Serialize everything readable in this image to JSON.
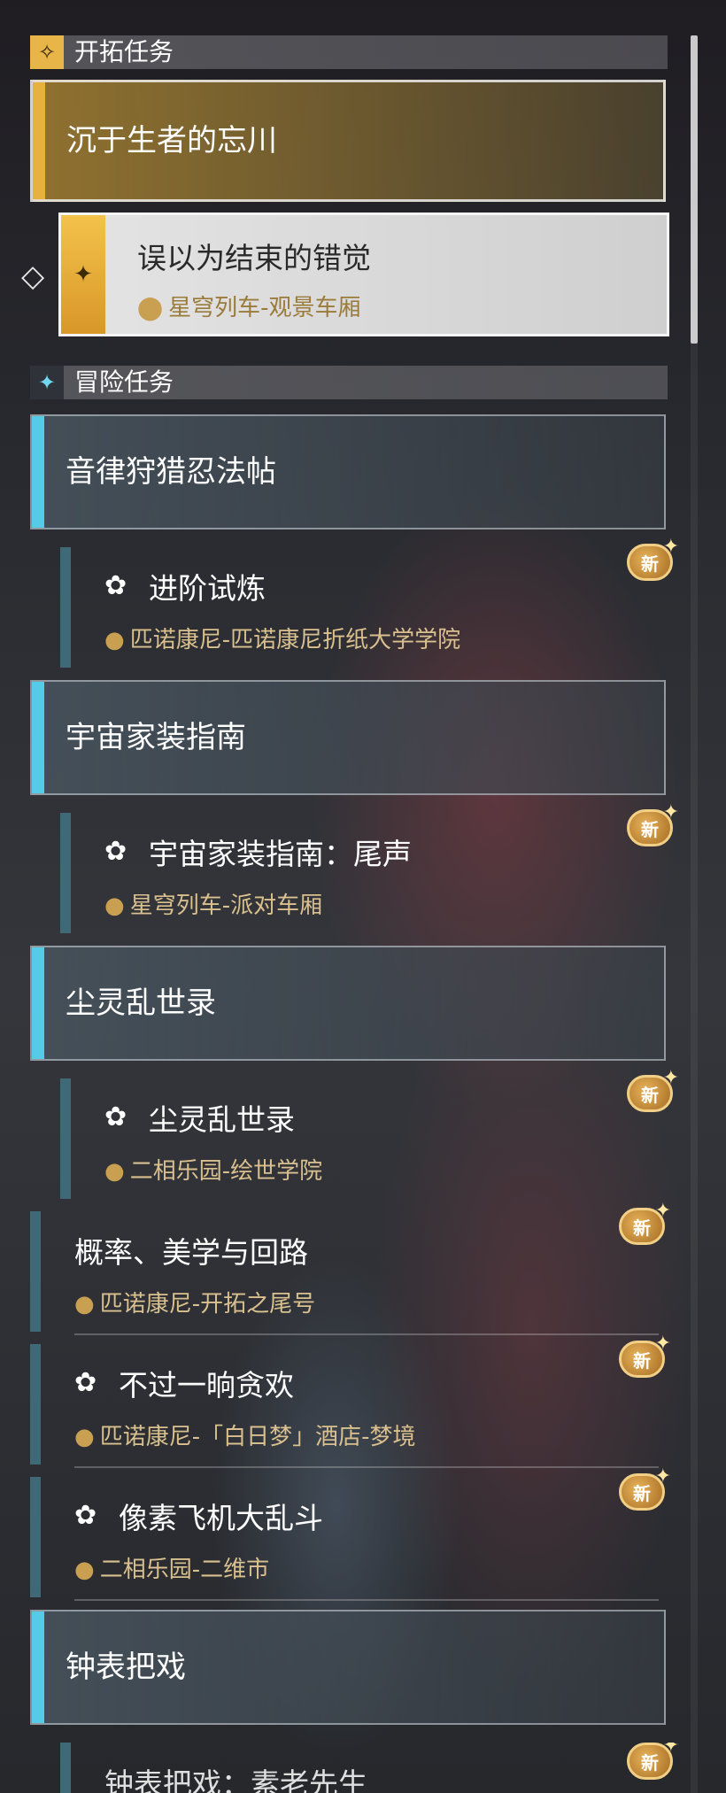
{
  "trailblaze": {
    "header": "开拓任务",
    "group_title": "沉于生者的忘川",
    "active": {
      "title": "误以为结束的错觉",
      "location": "星穹列车-观景车厢"
    }
  },
  "adventure": {
    "header": "冒险任务",
    "groups": [
      {
        "title": "音律狩猎忍法帖"
      },
      {
        "title": "宇宙家装指南"
      },
      {
        "title": "尘灵乱世录"
      },
      {
        "title": "钟表把戏"
      }
    ],
    "quests": [
      {
        "title": "进阶试炼",
        "location": "匹诺康尼-匹诺康尼折纸大学学院",
        "badge": "新"
      },
      {
        "title": "宇宙家装指南：尾声",
        "location": "星穹列车-派对车厢",
        "badge": "新"
      },
      {
        "title": "尘灵乱世录",
        "location": "二相乐园-绘世学院",
        "badge": "新"
      },
      {
        "title": "概率、美学与回路",
        "location": "匹诺康尼-开拓之尾号",
        "badge": "新"
      },
      {
        "title": "不过一晌贪欢",
        "location": "匹诺康尼-「白日梦」酒店-梦境",
        "badge": "新"
      },
      {
        "title": "像素飞机大乱斗",
        "location": "二相乐园-二维市",
        "badge": "新"
      },
      {
        "title": "钟表把戏：素老先生",
        "location": "",
        "badge": "新"
      }
    ]
  },
  "icons": {
    "trailblaze": "trailblaze-star-icon",
    "adventure": "adventure-star-icon",
    "quest": "quest-pawprint-icon",
    "location": "location-pin-icon",
    "pointer": "selection-arrow-icon"
  },
  "colors": {
    "gold": "#e8b13f",
    "cyan": "#55cbe8",
    "location_text": "#d9c08e"
  }
}
